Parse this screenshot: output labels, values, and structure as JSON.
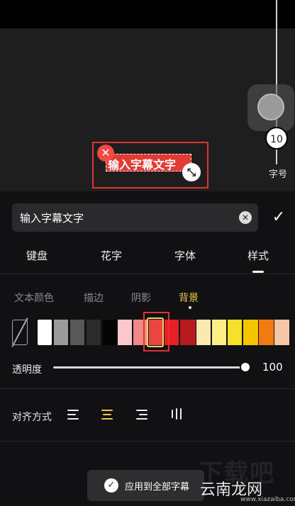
{
  "preview": {
    "caption_text": "输入字幕文字",
    "size_value": "10",
    "size_label": "字号"
  },
  "input": {
    "value": "输入字幕文字"
  },
  "tabs": [
    {
      "label": "键盘"
    },
    {
      "label": "花字"
    },
    {
      "label": "字体"
    },
    {
      "label": "样式",
      "active": true
    }
  ],
  "subtabs": [
    {
      "label": "文本颜色"
    },
    {
      "label": "描边"
    },
    {
      "label": "阴影"
    },
    {
      "label": "背景",
      "active": true
    }
  ],
  "swatches": [
    {
      "name": "none",
      "color": "none"
    },
    {
      "name": "white",
      "color": "#ffffff"
    },
    {
      "name": "gray-light",
      "color": "#9b9b9b"
    },
    {
      "name": "gray-dark",
      "color": "#585858"
    },
    {
      "name": "charcoal",
      "color": "#2b2b2b"
    },
    {
      "name": "black",
      "color": "#050505"
    },
    {
      "name": "pink-light",
      "color": "#fbc9cd"
    },
    {
      "name": "salmon",
      "color": "#ef8a88"
    },
    {
      "name": "coral",
      "color": "#e8463f",
      "selected": true
    },
    {
      "name": "red",
      "color": "#e81f25"
    },
    {
      "name": "dark-red",
      "color": "#b71b20"
    },
    {
      "name": "cream",
      "color": "#fde9b0"
    },
    {
      "name": "light-yellow",
      "color": "#fdef86"
    },
    {
      "name": "yellow",
      "color": "#f7e02c"
    },
    {
      "name": "amber",
      "color": "#f5c400"
    },
    {
      "name": "orange",
      "color": "#f27a12"
    },
    {
      "name": "peach",
      "color": "#f6c6a8"
    }
  ],
  "opacity": {
    "label": "透明度",
    "value": "100"
  },
  "alignment": {
    "label": "对齐方式",
    "selected": "center"
  },
  "apply_button": {
    "label": "应用到全部字幕"
  },
  "watermark": {
    "main": "云南龙网",
    "big": "下载吧",
    "small": "www.xiazaiba.com"
  }
}
